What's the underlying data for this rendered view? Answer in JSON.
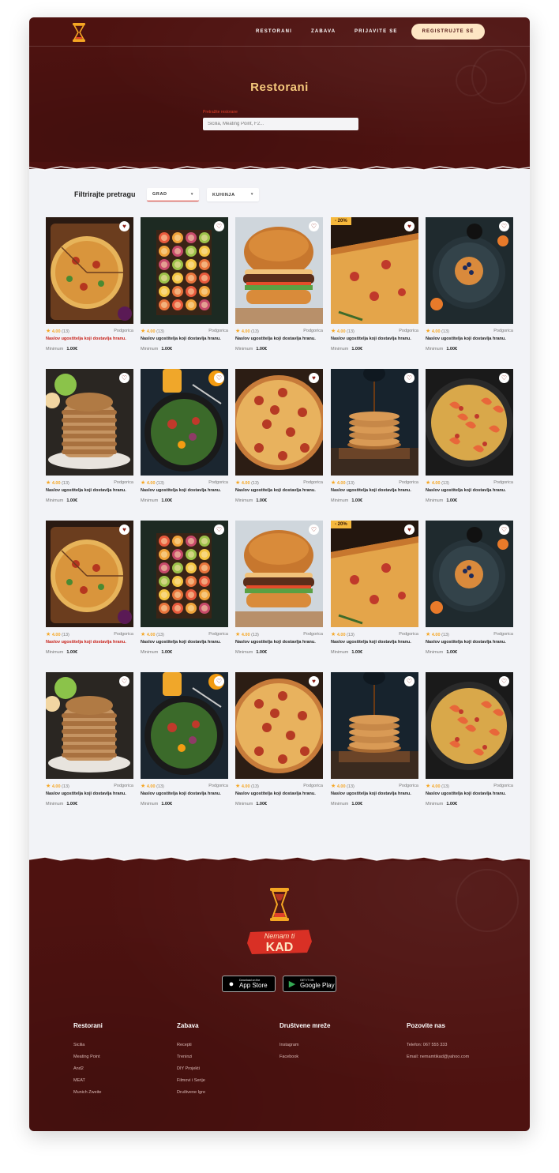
{
  "nav": {
    "links": [
      "RESTORANI",
      "ZABAVA",
      "PRIJAVITE SE"
    ],
    "cta": "REGISTRUJTE SE"
  },
  "hero": {
    "title": "Restorani",
    "search_label": "Pretražite restorane",
    "search_placeholder": "Sicilia, Meating Point, F2..."
  },
  "filter": {
    "label": "Filtrirajte pretragu",
    "city": "GRAD",
    "cuisine": "KUHINJA"
  },
  "card": {
    "rating": "4.00",
    "reviews": "(13)",
    "city": "Podgorica",
    "title": "Naslov ugostitelja koji dostavlja hranu.",
    "minimum_label": "Minimum",
    "minimum_value": "1.00€",
    "discount": "- 20%"
  },
  "rows": [
    [
      {
        "image": "pizza-board",
        "liked": true,
        "discount": false,
        "red_title": true
      },
      {
        "image": "citrus-slices",
        "liked": false,
        "discount": false,
        "red_title": false
      },
      {
        "image": "burger",
        "liked": false,
        "discount": false,
        "red_title": false
      },
      {
        "image": "pizza-slice",
        "liked": true,
        "discount": true,
        "red_title": false
      },
      {
        "image": "pancake-plate",
        "liked": false,
        "discount": false,
        "red_title": false
      }
    ],
    [
      {
        "image": "pancake-stack",
        "liked": false,
        "discount": false,
        "red_title": false
      },
      {
        "image": "salad",
        "liked": false,
        "discount": false,
        "red_title": false
      },
      {
        "image": "pizza-pepperoni",
        "liked": true,
        "discount": false,
        "red_title": false
      },
      {
        "image": "pancake-syrup",
        "liked": false,
        "discount": false,
        "red_title": false
      },
      {
        "image": "shrimp-pasta",
        "liked": false,
        "discount": false,
        "red_title": false
      }
    ],
    [
      {
        "image": "pizza-board",
        "liked": true,
        "discount": false,
        "red_title": true
      },
      {
        "image": "citrus-slices",
        "liked": false,
        "discount": false,
        "red_title": false
      },
      {
        "image": "burger",
        "liked": false,
        "discount": false,
        "red_title": false
      },
      {
        "image": "pizza-slice",
        "liked": true,
        "discount": true,
        "red_title": false
      },
      {
        "image": "pancake-plate",
        "liked": false,
        "discount": false,
        "red_title": false
      }
    ],
    [
      {
        "image": "pancake-stack",
        "liked": false,
        "discount": false,
        "red_title": false
      },
      {
        "image": "salad",
        "liked": false,
        "discount": false,
        "red_title": false
      },
      {
        "image": "pizza-pepperoni",
        "liked": true,
        "discount": false,
        "red_title": false
      },
      {
        "image": "pancake-syrup",
        "liked": false,
        "discount": false,
        "red_title": false
      },
      {
        "image": "shrimp-pasta",
        "liked": false,
        "discount": false,
        "red_title": false
      }
    ]
  ],
  "footer": {
    "logo_text_top": "Nemam ti",
    "logo_text_bottom": "KAD",
    "app_store_small": "Download on the",
    "app_store_big": "App Store",
    "google_small": "GET IT ON",
    "google_big": "Google Play",
    "columns": [
      {
        "title": "Restorani",
        "links": [
          "Sicilia",
          "Meating Point",
          "And2",
          "MEAT",
          "Munich Zweite"
        ]
      },
      {
        "title": "Zabava",
        "links": [
          "Recepti",
          "Treninzi",
          "DIY Projekti",
          "Filmovi i Serije",
          "Društvene Igre"
        ]
      },
      {
        "title": "Društvene mreže",
        "links": [
          "Instagram",
          "Facebook"
        ]
      },
      {
        "title": "Pozovite nas",
        "links": [
          "Telefon: 067 555 333",
          "Email: nemamtikad@yahoo.com"
        ]
      }
    ]
  },
  "colors": {
    "brand_dark": "#4e1210",
    "accent_gold": "#f6c97c",
    "cta_bg": "#fde6c4",
    "discount": "#f5b83c",
    "star": "#f5a623"
  }
}
